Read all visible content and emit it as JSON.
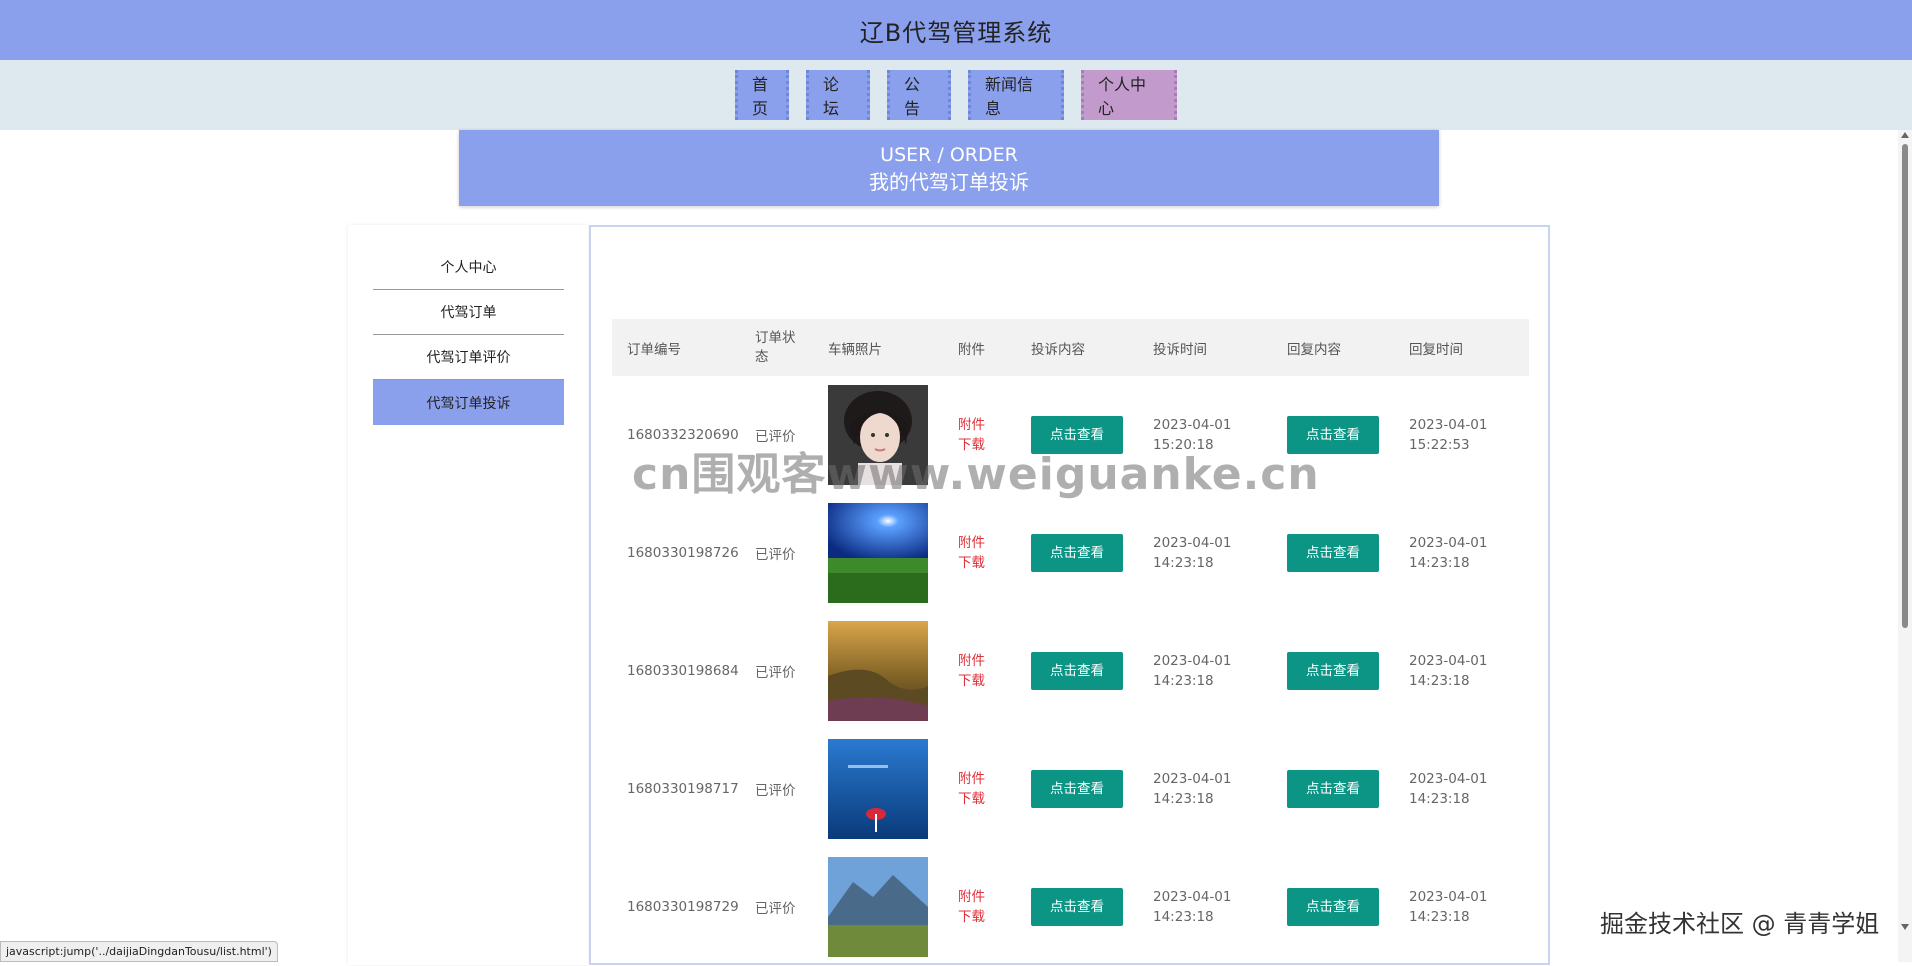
{
  "header": {
    "title": "辽B代驾管理系统"
  },
  "nav": {
    "items": [
      {
        "label": "首页"
      },
      {
        "label": "论坛"
      },
      {
        "label": "公告"
      },
      {
        "label": "新闻信息"
      },
      {
        "label": "个人中心"
      }
    ],
    "active": "个人中心"
  },
  "banner": {
    "en": "USER / ORDER",
    "cn": "我的代驾订单投诉"
  },
  "sidebar": {
    "items": [
      {
        "label": "个人中心"
      },
      {
        "label": "代驾订单"
      },
      {
        "label": "代驾订单评价"
      },
      {
        "label": "代驾订单投诉"
      }
    ],
    "active": "代驾订单投诉"
  },
  "table": {
    "headers": [
      "订单编号",
      "订单状态",
      "车辆照片",
      "附件",
      "投诉内容",
      "投诉时间",
      "回复内容",
      "回复时间"
    ],
    "rows": [
      {
        "order_no": "1680332320690",
        "status": "已评价",
        "photo": "portrait-girl",
        "attachment": "附件下载",
        "complaint_btn": "点击查看",
        "complaint_date": "2023-04-01",
        "complaint_time": "15:20:18",
        "reply_btn": "点击查看",
        "reply_date": "2023-04-01",
        "reply_time": "15:22:53"
      },
      {
        "order_no": "1680330198726",
        "status": "已评价",
        "photo": "blue-sky-meadow",
        "attachment": "附件下载",
        "complaint_btn": "点击查看",
        "complaint_date": "2023-04-01",
        "complaint_time": "14:23:18",
        "reply_btn": "点击查看",
        "reply_date": "2023-04-01",
        "reply_time": "14:23:18"
      },
      {
        "order_no": "1680330198684",
        "status": "已评价",
        "photo": "golden-valley",
        "attachment": "附件下载",
        "complaint_btn": "点击查看",
        "complaint_date": "2023-04-01",
        "complaint_time": "14:23:18",
        "reply_btn": "点击查看",
        "reply_date": "2023-04-01",
        "reply_time": "14:23:18"
      },
      {
        "order_no": "1680330198717",
        "status": "已评价",
        "photo": "blue-sea-umbrella",
        "attachment": "附件下载",
        "complaint_btn": "点击查看",
        "complaint_date": "2023-04-01",
        "complaint_time": "14:23:18",
        "reply_btn": "点击查看",
        "reply_date": "2023-04-01",
        "reply_time": "14:23:18"
      },
      {
        "order_no": "1680330198729",
        "status": "已评价",
        "photo": "mountain-pasture",
        "attachment": "附件下载",
        "complaint_btn": "点击查看",
        "complaint_date": "2023-04-01",
        "complaint_time": "14:23:18",
        "reply_btn": "点击查看",
        "reply_date": "2023-04-01",
        "reply_time": "14:23:18"
      }
    ]
  },
  "status_bar": {
    "text": "javascript:jump('../daijiaDingdanTousu/list.html')"
  },
  "watermark": {
    "text": "cn围观客www.weiguanke.cn"
  },
  "footer_watermark": {
    "text": "掘金技术社区 @ 青青学姐"
  },
  "colors": {
    "primary": "#8ba0ec",
    "nav_active": "#c39acc",
    "button": "#0c9484",
    "link_red": "#e0303a",
    "nav_bg": "#dde8ef"
  }
}
